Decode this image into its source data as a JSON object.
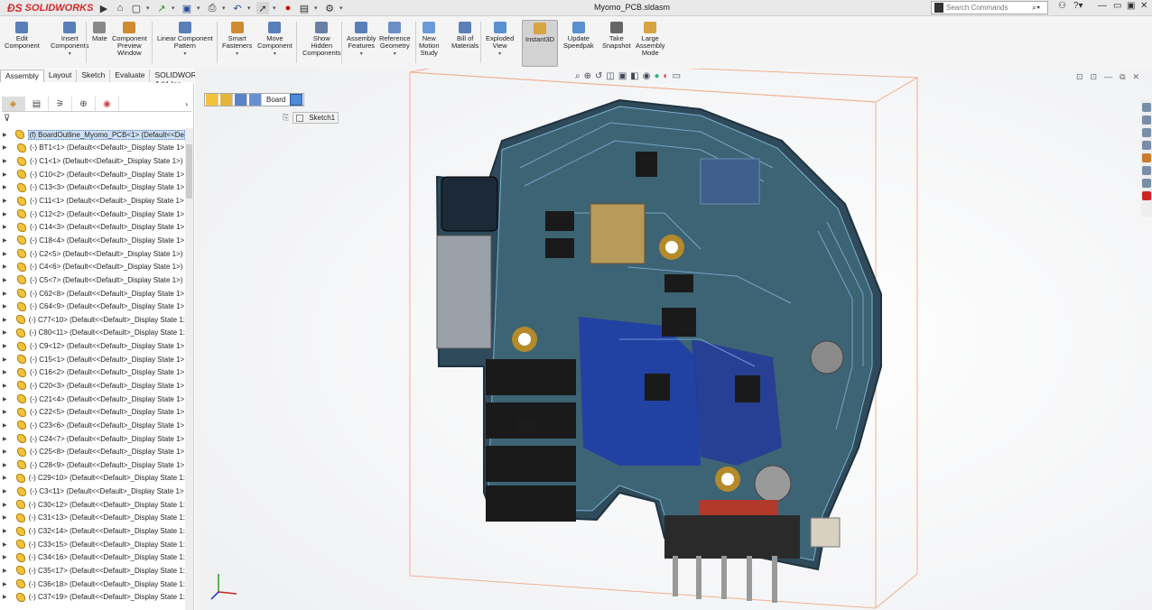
{
  "app": {
    "brand": "SOLIDWORKS",
    "title": "Myomo_PCB.sldasm"
  },
  "search": {
    "placeholder": "Search Commands"
  },
  "ribbon": [
    {
      "label": "Edit\nComponent"
    },
    {
      "label": "Insert\nComponents"
    },
    {
      "label": "Mate"
    },
    {
      "label": "Component\nPreview\nWindow"
    },
    {
      "label": "Linear Component\nPattern"
    },
    {
      "label": "Smart\nFasteners"
    },
    {
      "label": "Move\nComponent"
    },
    {
      "label": "Show\nHidden\nComponents"
    },
    {
      "label": "Assembly\nFeatures"
    },
    {
      "label": "Reference\nGeometry"
    },
    {
      "label": "New\nMotion\nStudy"
    },
    {
      "label": "Bill of\nMaterials"
    },
    {
      "label": "Exploded\nView"
    },
    {
      "label": "Instant3D"
    },
    {
      "label": "Update\nSpeedpak"
    },
    {
      "label": "Take\nSnapshot"
    },
    {
      "label": "Large\nAssembly\nMode"
    }
  ],
  "tabs": [
    "Assembly",
    "Layout",
    "Sketch",
    "Evaluate",
    "SOLIDWORKS Add-Ins"
  ],
  "tree": [
    "(f) BoardOutline_Myomo_PCB<1> (Default<<De",
    "(-) BT1<1> (Default<<Default>_Display State 1>",
    "(-) C1<1> (Default<<Default>_Display State 1>)",
    "(-) C10<2> (Default<<Default>_Display State 1>",
    "(-) C13<3> (Default<<Default>_Display State 1>",
    "(-) C11<1> (Default<<Default>_Display State 1>",
    "(-) C12<2> (Default<<Default>_Display State 1>",
    "(-) C14<3> (Default<<Default>_Display State 1>",
    "(-) C18<4> (Default<<Default>_Display State 1>",
    "(-) C2<5> (Default<<Default>_Display State 1>)",
    "(-) C4<6> (Default<<Default>_Display State 1>)",
    "(-) C5<7> (Default<<Default>_Display State 1>)",
    "(-) C62<8> (Default<<Default>_Display State 1>",
    "(-) C64<9> (Default<<Default>_Display State 1>",
    "(-) C77<10> (Default<<Default>_Display State 1:",
    "(-) C80<11> (Default<<Default>_Display State 1:",
    "(-) C9<12> (Default<<Default>_Display State 1>",
    "(-) C15<1> (Default<<Default>_Display State 1>",
    "(-) C16<2> (Default<<Default>_Display State 1>",
    "(-) C20<3> (Default<<Default>_Display State 1>",
    "(-) C21<4> (Default<<Default>_Display State 1>",
    "(-) C22<5> (Default<<Default>_Display State 1>",
    "(-) C23<6> (Default<<Default>_Display State 1>",
    "(-) C24<7> (Default<<Default>_Display State 1>",
    "(-) C25<8> (Default<<Default>_Display State 1>",
    "(-) C28<9> (Default<<Default>_Display State 1>",
    "(-) C29<10> (Default<<Default>_Display State 1:",
    "(-) C3<11> (Default<<Default>_Display State 1>",
    "(-) C30<12> (Default<<Default>_Display State 1:",
    "(-) C31<13> (Default<<Default>_Display State 1:",
    "(-) C32<14> (Default<<Default>_Display State 1:",
    "(-) C33<15> (Default<<Default>_Display State 1:",
    "(-) C34<16> (Default<<Default>_Display State 1:",
    "(-) C35<17> (Default<<Default>_Display State 1:",
    "(-) C36<18> (Default<<Default>_Display State 1:",
    "(-) C37<19> (Default<<Default>_Display State 1:"
  ],
  "breadcrumb": {
    "board": "Board",
    "sketch": "Sketch1"
  },
  "icons": [
    "home-icon",
    "new-document-icon",
    "open-icon",
    "save-icon",
    "print-icon",
    "undo-icon",
    "select-icon",
    "rebuild-icon",
    "options-icon",
    "search-icon",
    "user-icon",
    "help-icon"
  ]
}
